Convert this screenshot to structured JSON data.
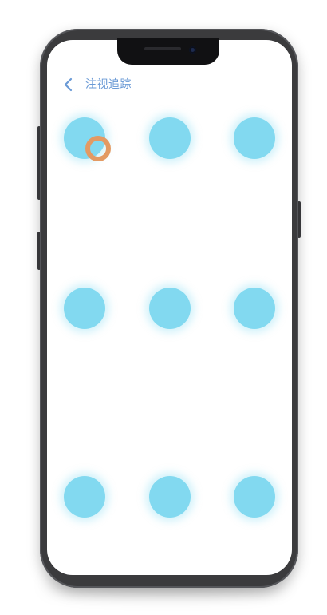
{
  "header": {
    "title": "注视追踪",
    "back_icon": "chevron-left-icon"
  },
  "colors": {
    "target_dot": "#82d9f0",
    "gaze_cursor": "#e39a63",
    "title_text": "#6a9ad6",
    "phone_frame": "#3b3b3d"
  },
  "grid": {
    "rows": 3,
    "columns": 3
  }
}
